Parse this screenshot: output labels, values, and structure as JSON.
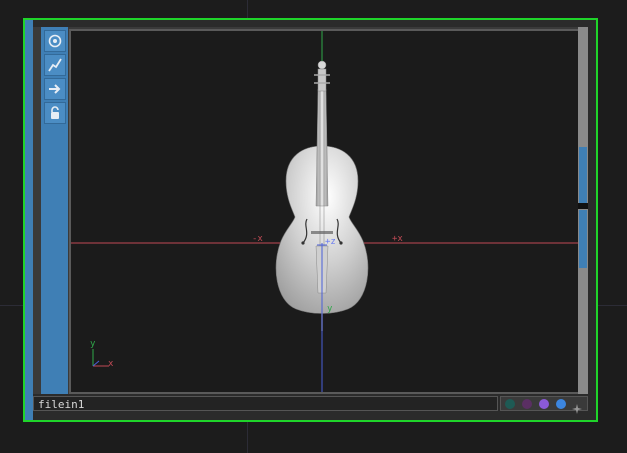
{
  "node": {
    "name": "filein1",
    "frame_color": "#1fd42a",
    "accent_color": "#3f7fb5"
  },
  "toolbar": {
    "tools": [
      {
        "icon": "target-icon"
      },
      {
        "icon": "pen-icon"
      },
      {
        "icon": "arrow-right-icon"
      },
      {
        "icon": "lock-icon"
      }
    ]
  },
  "viewport": {
    "model": "cello",
    "axis_labels": {
      "neg_x": "-x",
      "pos_x": "+x",
      "pos_z": "+z",
      "y": "y"
    },
    "gizmo": {
      "y": "y",
      "x": "x"
    },
    "axis_colors": {
      "x": "#c04a55",
      "y": "#2fa84a",
      "z": "#4a5fd8"
    }
  },
  "flags": [
    {
      "name": "bypass-flag",
      "color": "#1e5a54"
    },
    {
      "name": "lock-flag",
      "color": "#5a2f63"
    },
    {
      "name": "display-flag",
      "color": "#8b5ad8"
    },
    {
      "name": "render-flag",
      "color": "#3c86e0"
    },
    {
      "name": "pin-flag",
      "color": "#888888"
    }
  ]
}
